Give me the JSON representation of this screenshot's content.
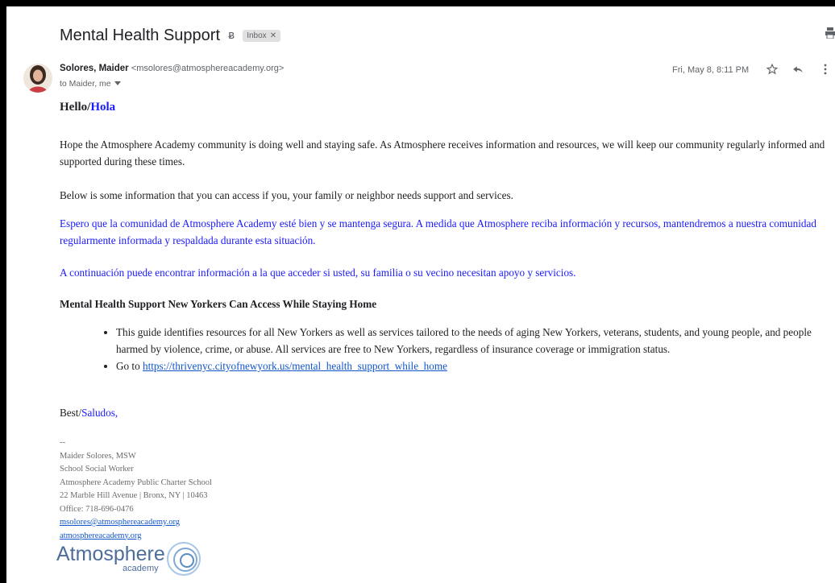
{
  "email": {
    "subject": "Mental Health Support",
    "label": "Inbox",
    "sender_name": "Solores, Maider",
    "sender_email": "<msolores@atmosphereacademy.org>",
    "to_line": "to Maider, me",
    "date": "Fri, May 8, 8:11 PM"
  },
  "body": {
    "greeting_en": "Hello/",
    "greeting_es": "Hola",
    "p1": "Hope the Atmosphere Academy community is doing well and staying safe. As Atmosphere receives information and resources, we will keep our community regularly informed and supported during these times.",
    "p2": "Below is some information that you can access if you, your family or neighbor needs support and services.",
    "p3": "Espero que la comunidad de Atmosphere Academy esté bien y se mantenga segura. A medida que Atmosphere reciba información y recursos, mantendremos a nuestra comunidad regularmente informada y respaldada durante esta situación.",
    "p4": "A continuación puede encontrar información a la que acceder si usted, su familia o su vecino necesitan apoyo y servicios.",
    "section_title": "Mental Health Support New Yorkers Can Access While Staying Home",
    "bullet1": "This guide identifies resources for all New Yorkers as well as services tailored to the needs of aging New Yorkers, veterans, students, and young people, and people harmed by violence, crime, or abuse. All services are free to New Yorkers, regardless of insurance coverage or immigration status.",
    "bullet2_prefix": "Go to ",
    "bullet2_link": "https://thrivenyc.cityofnewyork.us/mental_health_support_while_home",
    "signoff_en": "Best/",
    "signoff_es": "Saludos",
    "signoff_comma": ","
  },
  "signature": {
    "dash": "--",
    "name": "Maider Solores, MSW",
    "title": "School Social Worker",
    "org": "Atmosphere Academy Public Charter School",
    "address": "22 Marble Hill Avenue | Bronx, NY | 10463",
    "phone": "Office: 718-696-0476",
    "email_link": "msolores@atmosphereacademy.org",
    "site_link": "atmosphereacademy.org",
    "logo_word": "Atmosphere",
    "logo_sub": "academy"
  },
  "icons": [
    "importance-marker-icon",
    "print-icon",
    "star-icon",
    "reply-icon",
    "more-vert-icon",
    "chevron-down-icon",
    "label-close-icon"
  ],
  "colors": {
    "spanish_text": "#1a1aff",
    "link": "#1155cc",
    "logo": "#4d6e9a"
  }
}
